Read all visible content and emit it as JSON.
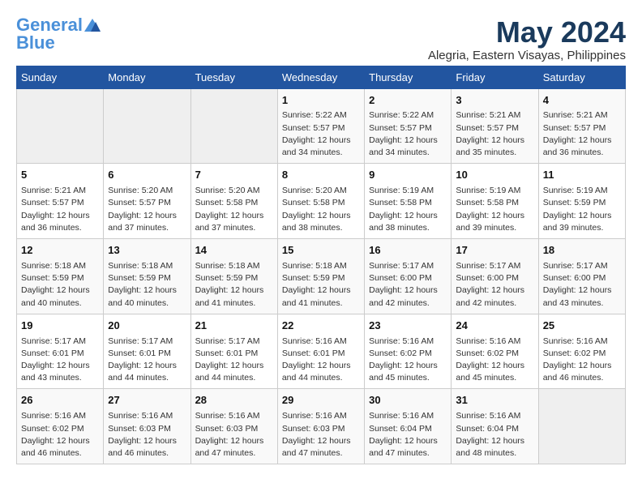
{
  "header": {
    "logo_line1": "General",
    "logo_line2": "Blue",
    "month": "May 2024",
    "location": "Alegria, Eastern Visayas, Philippines"
  },
  "weekdays": [
    "Sunday",
    "Monday",
    "Tuesday",
    "Wednesday",
    "Thursday",
    "Friday",
    "Saturday"
  ],
  "weeks": [
    [
      {
        "day": "",
        "info": ""
      },
      {
        "day": "",
        "info": ""
      },
      {
        "day": "",
        "info": ""
      },
      {
        "day": "1",
        "info": "Sunrise: 5:22 AM\nSunset: 5:57 PM\nDaylight: 12 hours\nand 34 minutes."
      },
      {
        "day": "2",
        "info": "Sunrise: 5:22 AM\nSunset: 5:57 PM\nDaylight: 12 hours\nand 34 minutes."
      },
      {
        "day": "3",
        "info": "Sunrise: 5:21 AM\nSunset: 5:57 PM\nDaylight: 12 hours\nand 35 minutes."
      },
      {
        "day": "4",
        "info": "Sunrise: 5:21 AM\nSunset: 5:57 PM\nDaylight: 12 hours\nand 36 minutes."
      }
    ],
    [
      {
        "day": "5",
        "info": "Sunrise: 5:21 AM\nSunset: 5:57 PM\nDaylight: 12 hours\nand 36 minutes."
      },
      {
        "day": "6",
        "info": "Sunrise: 5:20 AM\nSunset: 5:57 PM\nDaylight: 12 hours\nand 37 minutes."
      },
      {
        "day": "7",
        "info": "Sunrise: 5:20 AM\nSunset: 5:58 PM\nDaylight: 12 hours\nand 37 minutes."
      },
      {
        "day": "8",
        "info": "Sunrise: 5:20 AM\nSunset: 5:58 PM\nDaylight: 12 hours\nand 38 minutes."
      },
      {
        "day": "9",
        "info": "Sunrise: 5:19 AM\nSunset: 5:58 PM\nDaylight: 12 hours\nand 38 minutes."
      },
      {
        "day": "10",
        "info": "Sunrise: 5:19 AM\nSunset: 5:58 PM\nDaylight: 12 hours\nand 39 minutes."
      },
      {
        "day": "11",
        "info": "Sunrise: 5:19 AM\nSunset: 5:59 PM\nDaylight: 12 hours\nand 39 minutes."
      }
    ],
    [
      {
        "day": "12",
        "info": "Sunrise: 5:18 AM\nSunset: 5:59 PM\nDaylight: 12 hours\nand 40 minutes."
      },
      {
        "day": "13",
        "info": "Sunrise: 5:18 AM\nSunset: 5:59 PM\nDaylight: 12 hours\nand 40 minutes."
      },
      {
        "day": "14",
        "info": "Sunrise: 5:18 AM\nSunset: 5:59 PM\nDaylight: 12 hours\nand 41 minutes."
      },
      {
        "day": "15",
        "info": "Sunrise: 5:18 AM\nSunset: 5:59 PM\nDaylight: 12 hours\nand 41 minutes."
      },
      {
        "day": "16",
        "info": "Sunrise: 5:17 AM\nSunset: 6:00 PM\nDaylight: 12 hours\nand 42 minutes."
      },
      {
        "day": "17",
        "info": "Sunrise: 5:17 AM\nSunset: 6:00 PM\nDaylight: 12 hours\nand 42 minutes."
      },
      {
        "day": "18",
        "info": "Sunrise: 5:17 AM\nSunset: 6:00 PM\nDaylight: 12 hours\nand 43 minutes."
      }
    ],
    [
      {
        "day": "19",
        "info": "Sunrise: 5:17 AM\nSunset: 6:01 PM\nDaylight: 12 hours\nand 43 minutes."
      },
      {
        "day": "20",
        "info": "Sunrise: 5:17 AM\nSunset: 6:01 PM\nDaylight: 12 hours\nand 44 minutes."
      },
      {
        "day": "21",
        "info": "Sunrise: 5:17 AM\nSunset: 6:01 PM\nDaylight: 12 hours\nand 44 minutes."
      },
      {
        "day": "22",
        "info": "Sunrise: 5:16 AM\nSunset: 6:01 PM\nDaylight: 12 hours\nand 44 minutes."
      },
      {
        "day": "23",
        "info": "Sunrise: 5:16 AM\nSunset: 6:02 PM\nDaylight: 12 hours\nand 45 minutes."
      },
      {
        "day": "24",
        "info": "Sunrise: 5:16 AM\nSunset: 6:02 PM\nDaylight: 12 hours\nand 45 minutes."
      },
      {
        "day": "25",
        "info": "Sunrise: 5:16 AM\nSunset: 6:02 PM\nDaylight: 12 hours\nand 46 minutes."
      }
    ],
    [
      {
        "day": "26",
        "info": "Sunrise: 5:16 AM\nSunset: 6:02 PM\nDaylight: 12 hours\nand 46 minutes."
      },
      {
        "day": "27",
        "info": "Sunrise: 5:16 AM\nSunset: 6:03 PM\nDaylight: 12 hours\nand 46 minutes."
      },
      {
        "day": "28",
        "info": "Sunrise: 5:16 AM\nSunset: 6:03 PM\nDaylight: 12 hours\nand 47 minutes."
      },
      {
        "day": "29",
        "info": "Sunrise: 5:16 AM\nSunset: 6:03 PM\nDaylight: 12 hours\nand 47 minutes."
      },
      {
        "day": "30",
        "info": "Sunrise: 5:16 AM\nSunset: 6:04 PM\nDaylight: 12 hours\nand 47 minutes."
      },
      {
        "day": "31",
        "info": "Sunrise: 5:16 AM\nSunset: 6:04 PM\nDaylight: 12 hours\nand 48 minutes."
      },
      {
        "day": "",
        "info": ""
      }
    ]
  ]
}
